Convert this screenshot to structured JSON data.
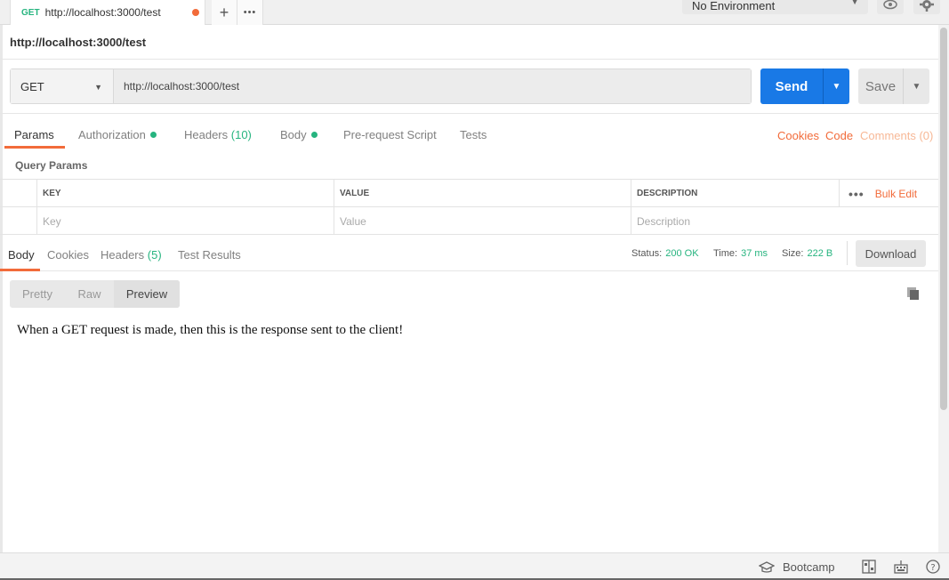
{
  "tab": {
    "method": "GET",
    "title": "http://localhost:3000/test",
    "new_tab_icon": "+",
    "more_icon": "•••"
  },
  "environment": {
    "selected": "No Environment"
  },
  "request": {
    "name": "http://localhost:3000/test",
    "method": "GET",
    "url": "http://localhost:3000/test",
    "send_label": "Send",
    "save_label": "Save"
  },
  "request_tabs": {
    "params": "Params",
    "authorization": "Authorization",
    "headers": "Headers",
    "headers_count": "(10)",
    "body": "Body",
    "prerequest": "Pre-request Script",
    "tests": "Tests",
    "cookies": "Cookies",
    "code": "Code",
    "comments": "Comments (0)"
  },
  "query_params": {
    "label": "Query Params",
    "columns": {
      "key": "KEY",
      "value": "VALUE",
      "description": "DESCRIPTION"
    },
    "bulk_edit": "Bulk Edit",
    "placeholders": {
      "key": "Key",
      "value": "Value",
      "description": "Description"
    }
  },
  "response_tabs": {
    "body": "Body",
    "cookies": "Cookies",
    "headers": "Headers",
    "headers_count": "(5)",
    "test_results": "Test Results"
  },
  "response_status": {
    "status_label": "Status:",
    "status_value": "200 OK",
    "time_label": "Time:",
    "time_value": "37 ms",
    "size_label": "Size:",
    "size_value": "222 B",
    "download_label": "Download"
  },
  "view_modes": {
    "pretty": "Pretty",
    "raw": "Raw",
    "preview": "Preview",
    "selected": "Preview"
  },
  "response_body": "When a GET request is made, then this is the response sent to the client!",
  "statusbar": {
    "bootcamp": "Bootcamp"
  },
  "colors": {
    "accent": "#f26b3a",
    "send": "#1979e6",
    "success": "#26b47f"
  }
}
